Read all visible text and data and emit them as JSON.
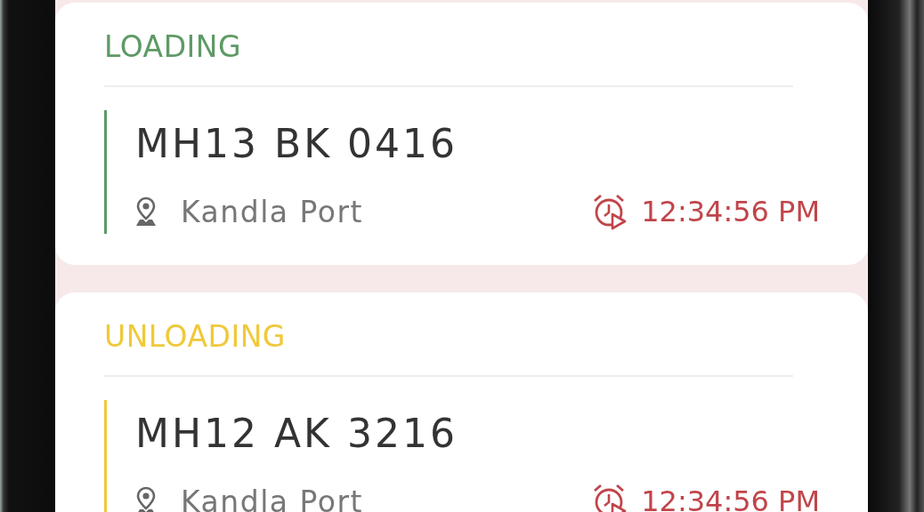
{
  "trips": [
    {
      "status": "LOADING",
      "color": "#5e9a66",
      "plate": "MH13 BK 0416",
      "location": "Kandla Port",
      "time": "12:34:56 PM"
    },
    {
      "status": "UNLOADING",
      "color": "#efc93a",
      "plate": "MH12 AK 3216",
      "location": "Kandla Port",
      "time": "12:34:56 PM"
    }
  ]
}
